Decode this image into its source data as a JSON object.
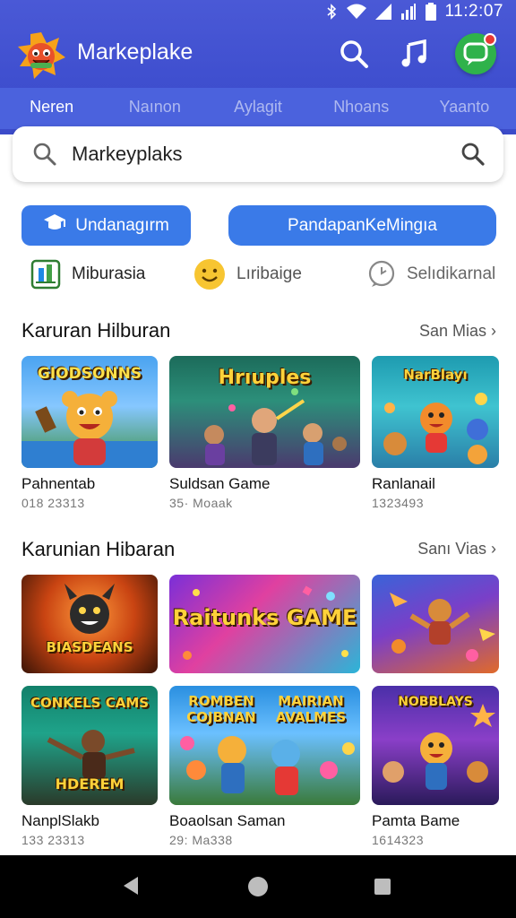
{
  "status": {
    "time": "11:2:07"
  },
  "app": {
    "title": "Markeplake"
  },
  "tabs": [
    "Neren",
    "Naınon",
    "Aylagit",
    "Nhoans",
    "Yaanto"
  ],
  "search": {
    "value": "Markeyplaks"
  },
  "buttons": {
    "primary": "Undanagırm",
    "secondary": "PandapanKeMingıa"
  },
  "chips": [
    "Miburasia",
    "Lıribaige",
    "Selıdikarnal"
  ],
  "section1": {
    "title": "Karuran Hilburan",
    "more": "San Mias",
    "items": [
      {
        "name": "Pahnentab",
        "sub": "018 23313",
        "art": "GIODSONNS"
      },
      {
        "name": "Suldsan Game",
        "sub": "35· Moaak",
        "art": "Hrıuples"
      },
      {
        "name": "Ranlanail",
        "sub": "1323493",
        "art": "NarBlayı"
      }
    ]
  },
  "section2": {
    "title": "Karunian Hibaran",
    "more": "Sanı Vias",
    "row1": [
      {
        "art": "BIASDEANS"
      },
      {
        "art": "Raitunks GAME"
      },
      {
        "art": ""
      }
    ],
    "row2": [
      {
        "name": "NanplSlakb",
        "sub": "133 23313",
        "art": "CONKELS CAMS"
      },
      {
        "name": "Boaolsan Saman",
        "sub": "29: Ma338",
        "art": "ROMBEN COJBNAN"
      },
      {
        "name": "Pamta Bame",
        "sub": "1614323",
        "art": "NOBBLAYS"
      }
    ],
    "row2_extra_art": [
      "HDEREM",
      "MAIRIAN AVALMES"
    ]
  },
  "colors": {
    "primary": "#4a59d6",
    "tab_bar": "#4b62dd",
    "button": "#3a7ae8",
    "chat_green": "#2fb24b"
  }
}
